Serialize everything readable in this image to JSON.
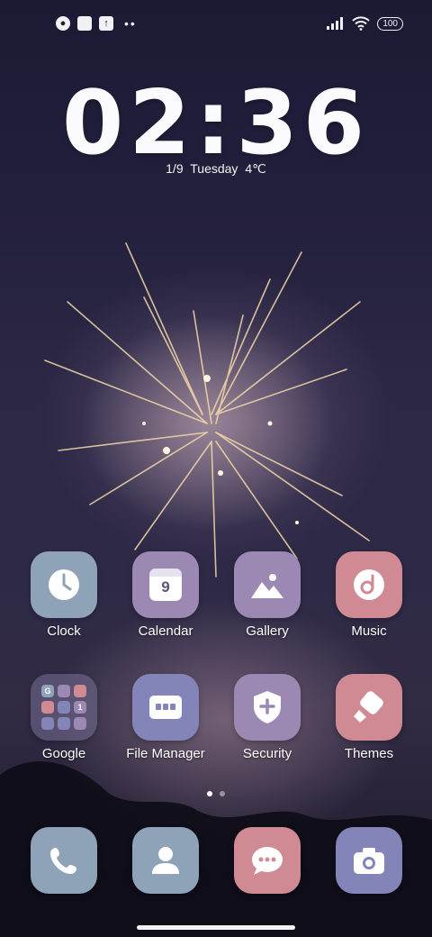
{
  "status_bar": {
    "battery": "100"
  },
  "clock_widget": {
    "time": "02:36",
    "date": "1/9",
    "weekday": "Tuesday",
    "temperature": "4℃"
  },
  "apps": [
    {
      "label": "Clock",
      "icon": "clock-icon",
      "color": "#8ea2b8"
    },
    {
      "label": "Calendar",
      "icon": "calendar-icon",
      "color": "#9b89b4",
      "calendar_day": "9"
    },
    {
      "label": "Gallery",
      "icon": "image-icon",
      "color": "#9b89b4"
    },
    {
      "label": "Music",
      "icon": "music-icon",
      "color": "#cf8a93"
    },
    {
      "label": "Google",
      "icon": "folder-icon",
      "color": "#6f6a8a"
    },
    {
      "label": "File Manager",
      "icon": "folder-icon",
      "color": "#8384b8"
    },
    {
      "label": "Security",
      "icon": "shield-icon",
      "color": "#9b89b4"
    },
    {
      "label": "Themes",
      "icon": "brush-icon",
      "color": "#cf8a93"
    }
  ],
  "folder_mini_icons": [
    {
      "icon": "google-g-icon",
      "color": "#8ea2b8",
      "text": "G"
    },
    {
      "icon": "image-mini-icon",
      "color": "#9b89b4",
      "text": ""
    },
    {
      "icon": "maps-pin-icon",
      "color": "#cf8a93",
      "text": ""
    },
    {
      "icon": "youtube-icon",
      "color": "#cf8a93",
      "text": ""
    },
    {
      "icon": "music-mini-icon",
      "color": "#8384b8",
      "text": ""
    },
    {
      "icon": "one-icon",
      "color": "#9b89b4",
      "text": "1"
    },
    {
      "icon": "chrome-icon",
      "color": "#8384b8",
      "text": ""
    },
    {
      "icon": "duo-icon",
      "color": "#8384b8",
      "text": ""
    },
    {
      "icon": "files-icon",
      "color": "#9b89b4",
      "text": ""
    }
  ],
  "pager": {
    "pages": 2,
    "active": 1
  },
  "dock": [
    {
      "icon": "phone-icon",
      "color": "#8ea2b8"
    },
    {
      "icon": "contacts-icon",
      "color": "#8ea2b8"
    },
    {
      "icon": "messages-icon",
      "color": "#cf8a93"
    },
    {
      "icon": "camera-icon",
      "color": "#8384b8"
    }
  ]
}
